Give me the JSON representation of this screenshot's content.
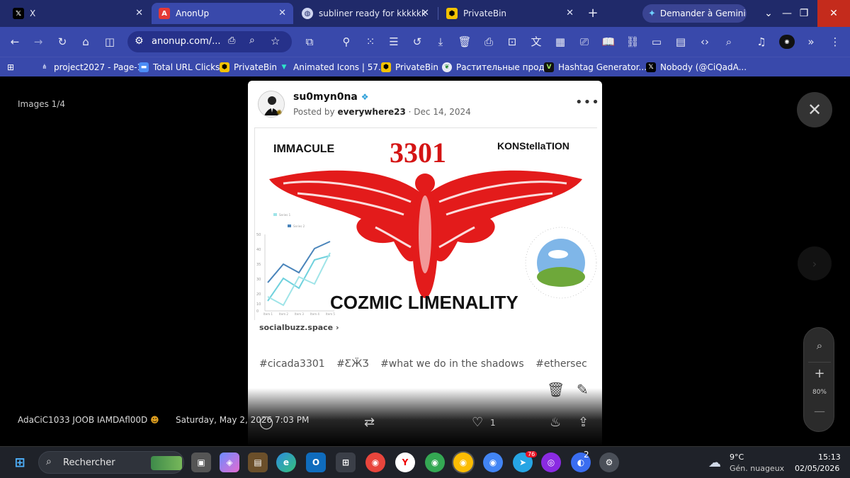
{
  "browser": {
    "tabs": [
      {
        "title": "X",
        "icon": "x-logo-icon"
      },
      {
        "title": "AnonUp",
        "icon": "anonup-icon"
      },
      {
        "title": "subliner ready for kkkkkk",
        "icon": "globe-icon"
      },
      {
        "title": "PrivateBin",
        "icon": "privatebin-icon"
      }
    ],
    "new_tab": "+",
    "gemini_label": "Demander à Gemini",
    "url": "anonup.com/...",
    "bookmarks": [
      "project2027 - Page-1",
      "Total URL Clicks",
      "PrivateBin",
      "Animated Icons | 57...",
      "PrivateBin",
      "Растительные прод...",
      "Hashtag Generator...",
      "Nobody (@CiQadA..."
    ]
  },
  "viewer": {
    "counter": "Images 1/4",
    "zoom_level": "80%",
    "footer_user": "AdaCiC1033 JOOB IAMDAfl00D",
    "footer_date": "Saturday, May 2, 2026 7:03 PM",
    "like_count": "1"
  },
  "post": {
    "username": "su0myn0na",
    "posted_by_prefix": "Posted by",
    "author": "everywhere23",
    "date": "· Dec 14, 2024",
    "more": "•••",
    "link_domain": "socialbuzz.space",
    "hashtags": [
      "#cicada3301",
      "#ƸӜƷ",
      "#what we do in the shadows",
      "#ethersec"
    ],
    "image": {
      "top_left": "IMMACULE",
      "top_center": "3301",
      "top_right": "KONStellaTION",
      "bottom": "COZMIC LIMENALITY",
      "legend": [
        "Series 1",
        "Series 2"
      ],
      "y_ticks": [
        "50",
        "40",
        "35",
        "30",
        "20",
        "10",
        "0"
      ],
      "x_ticks": [
        "Item 1",
        "Item 2",
        "Item 3",
        "Item 4",
        "Item 5"
      ]
    }
  },
  "taskbar": {
    "search_label": "Rechercher",
    "weather_temp": "9°C",
    "weather_desc": "Gén. nuageux",
    "time": "15:13",
    "date": "02/05/2026",
    "badge_telegram": "76",
    "badge_app": "2"
  },
  "colors": {
    "tabbar": "#202a6a",
    "toolbar": "#3949ab",
    "close": "#c42b1c",
    "moth": "#e31b1b"
  }
}
